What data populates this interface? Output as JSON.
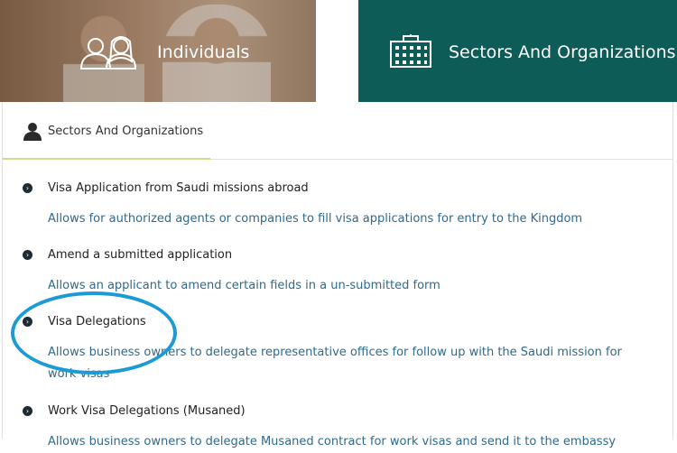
{
  "tabs": {
    "individuals_label": "Individuals",
    "sectors_label": "Sectors And Organizations"
  },
  "subtab": {
    "label": "Sectors And Organizations"
  },
  "services": [
    {
      "title": "Visa Application from Saudi missions abroad",
      "description": "Allows for authorized agents or companies to fill visa applications for entry to the Kingdom"
    },
    {
      "title": "Amend a submitted application",
      "description": "Allows an applicant to amend certain fields in a un-submitted form"
    },
    {
      "title": "Visa Delegations",
      "description": "Allows business owners to delegate representative offices for follow up with the Saudi mission for work visas"
    },
    {
      "title": "Work Visa Delegations (Musaned)",
      "description": "Allows business owners to delegate Musaned contract for work visas and send it to the embassy"
    }
  ],
  "colors": {
    "sectors_tab_bg": "#0d5c58",
    "link_text": "#2f6a8c",
    "highlight_circle": "#1c9ad6"
  },
  "icons": {
    "individuals": "people-icon",
    "sectors": "building-icon",
    "subtab": "user-icon",
    "bullet": "chevron-right-circle-icon"
  }
}
